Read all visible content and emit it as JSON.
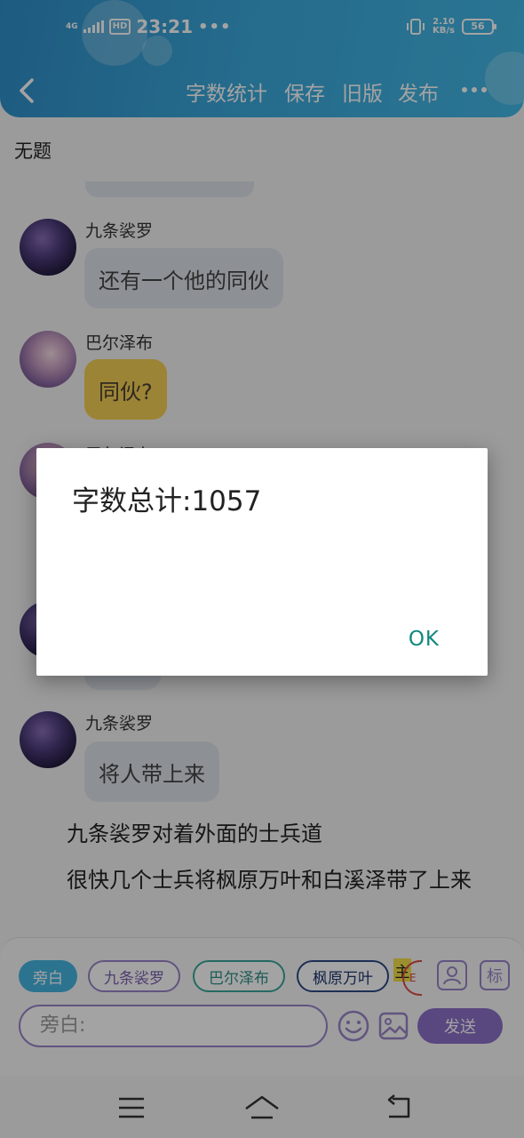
{
  "status_bar": {
    "network": "4G",
    "hd": "HD",
    "time": "23:21",
    "dots": "•••",
    "rate_top": "2.10",
    "rate_bottom": "KB/s",
    "battery": "56"
  },
  "toolbar": {
    "word_count": "字数统计",
    "save": "保存",
    "old_version": "旧版",
    "publish": "发布"
  },
  "document": {
    "title": "无题"
  },
  "messages": [
    {
      "sender": "九条裟罗",
      "text": "还有一个他的同伙",
      "style": "gray"
    },
    {
      "sender": "巴尔泽布",
      "text": "同伙?",
      "style": "yellow"
    },
    {
      "sender": "巴尔泽布",
      "text": "",
      "style": "hidden"
    },
    {
      "sender": "九条裟罗",
      "text": "将人带上来",
      "style": "gray"
    }
  ],
  "narration": [
    "九条裟罗对着外面的士兵道",
    "很快几个士兵将枫原万叶和白溪泽带了上来"
  ],
  "characters": [
    {
      "label": "旁白",
      "color": "#45b5e2",
      "active": true
    },
    {
      "label": "九条裟罗",
      "color": "#9a84c8",
      "active": false
    },
    {
      "label": "巴尔泽布",
      "color": "#3aa59a",
      "active": false
    },
    {
      "label": "枫原万叶",
      "color": "#2e4a86",
      "active": false
    }
  ],
  "char_main": "主",
  "char_partial": "E",
  "tag_button": "标",
  "input": {
    "placeholder": "旁白:"
  },
  "send_label": "发送",
  "dialog": {
    "message": "字数总计:1057",
    "ok_label": "OK"
  }
}
